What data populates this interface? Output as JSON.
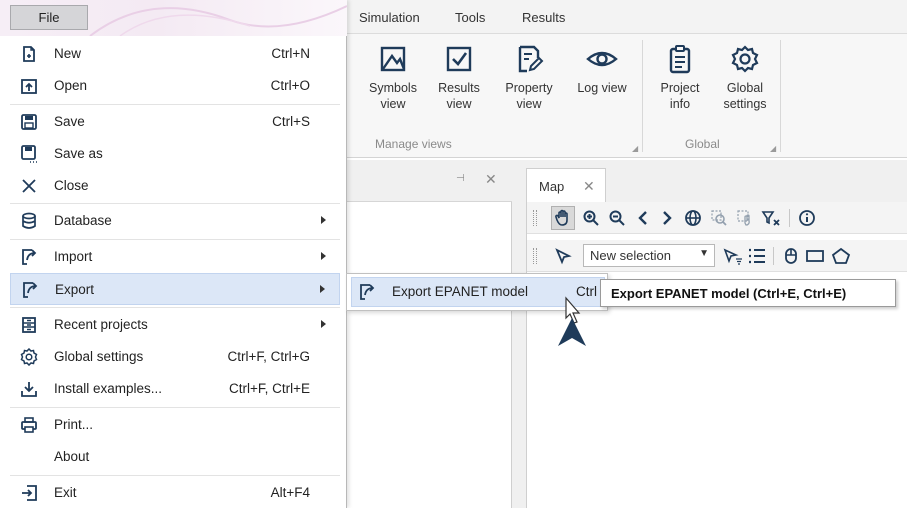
{
  "ribbon": {
    "tabs": [
      "Simulation",
      "Tools",
      "Results"
    ],
    "buttons": [
      {
        "label": "Symbols\nview",
        "icon": "symbols-view-icon"
      },
      {
        "label": "Results\nview",
        "icon": "results-view-icon"
      },
      {
        "label": "Property\nview",
        "icon": "property-view-icon"
      },
      {
        "label": "Log view",
        "icon": "log-view-icon"
      },
      {
        "label": "Project\ninfo",
        "icon": "project-info-icon"
      },
      {
        "label": "Global\nsettings",
        "icon": "global-settings-icon"
      }
    ],
    "groups": [
      "Manage views",
      "Global"
    ]
  },
  "map_tab": {
    "label": "Map"
  },
  "map_toolbar": {
    "selection_value": "New selection"
  },
  "file_menu": {
    "tab_label": "File",
    "items": [
      {
        "label": "New",
        "shortcut": "Ctrl+N",
        "icon": "new-file-icon"
      },
      {
        "label": "Open",
        "shortcut": "Ctrl+O",
        "icon": "open-icon"
      },
      {
        "label": "Save",
        "shortcut": "Ctrl+S",
        "icon": "save-icon"
      },
      {
        "label": "Save as",
        "shortcut": "",
        "icon": "save-as-icon"
      },
      {
        "label": "Close",
        "shortcut": "",
        "icon": "close-icon"
      },
      {
        "label": "Database",
        "shortcut": "",
        "icon": "database-icon"
      },
      {
        "label": "Import",
        "shortcut": "",
        "icon": "import-icon"
      },
      {
        "label": "Export",
        "shortcut": "",
        "icon": "export-icon"
      },
      {
        "label": "Recent projects",
        "shortcut": "",
        "icon": "recent-projects-icon"
      },
      {
        "label": "Global settings",
        "shortcut": "Ctrl+F, Ctrl+G",
        "icon": "gear-icon"
      },
      {
        "label": "Install examples...",
        "shortcut": "Ctrl+F, Ctrl+E",
        "icon": "download-icon"
      },
      {
        "label": "Print...",
        "shortcut": "",
        "icon": "printer-icon"
      },
      {
        "label": "About",
        "shortcut": "",
        "icon": ""
      },
      {
        "label": "Exit",
        "shortcut": "Alt+F4",
        "icon": "exit-icon"
      }
    ]
  },
  "export_submenu": {
    "label": "Export EPANET model",
    "shortcut": "Ctrl"
  },
  "tooltip": {
    "text": "Export EPANET model (Ctrl+E, Ctrl+E)"
  },
  "colors": {
    "highlight": "#dce7f7",
    "highlight_border": "#c2d4ef",
    "accent_icon": "#1f3b5a"
  }
}
